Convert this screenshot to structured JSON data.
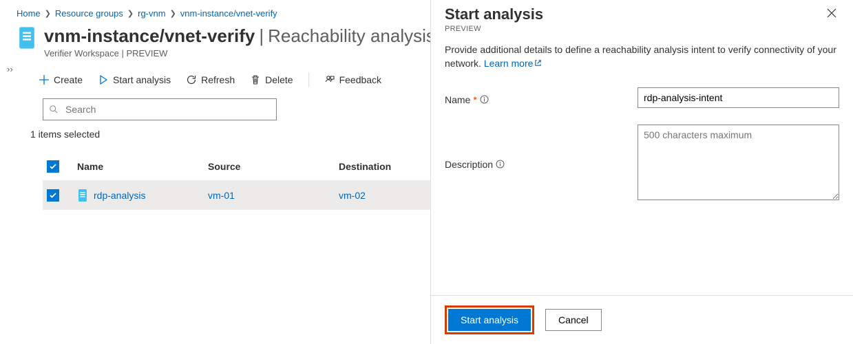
{
  "breadcrumb": {
    "home": "Home",
    "rg": "Resource groups",
    "group": "rg-vnm",
    "resource": "vnm-instance/vnet-verify"
  },
  "header": {
    "title": "vnm-instance/vnet-verify",
    "separator": "|",
    "page": "Reachability analysis",
    "subtitle": "Verifier Workspace | PREVIEW"
  },
  "toolbar": {
    "create": "Create",
    "start": "Start analysis",
    "refresh": "Refresh",
    "delete": "Delete",
    "feedback": "Feedback"
  },
  "search": {
    "placeholder": "Search",
    "value": ""
  },
  "status": "1 items selected",
  "table": {
    "headers": {
      "name": "Name",
      "source": "Source",
      "destination": "Destination"
    },
    "rows": [
      {
        "name": "rdp-analysis",
        "source": "vm-01",
        "destination": "vm-02"
      }
    ]
  },
  "panel": {
    "title": "Start analysis",
    "sub": "PREVIEW",
    "desc_pre": "Provide additional details to define a reachability analysis intent to verify connectivity of your network. ",
    "learn": "Learn more",
    "form": {
      "name_label": "Name",
      "name_value": "rdp-analysis-intent",
      "desc_label": "Description",
      "desc_placeholder": "500 characters maximum"
    },
    "footer": {
      "primary": "Start analysis",
      "secondary": "Cancel"
    }
  }
}
